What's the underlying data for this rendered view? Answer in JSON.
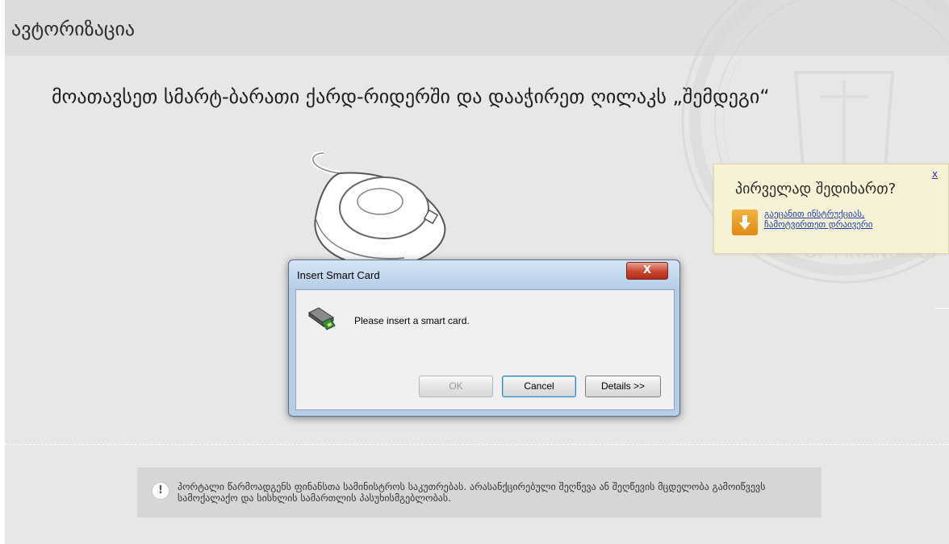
{
  "header": {
    "title": "ავტორიზაცია"
  },
  "main": {
    "instruction": "მოათავსეთ სმარტ-ბარათი ქარდ-რიდერში და დააჭირეთ ღილაკს „შემდეგი“"
  },
  "help_box": {
    "title": "პირველად შედიხართ?",
    "close_label": "x",
    "link_text": "გაეცანით ინსტრუქციას, ჩამოტვირთეთ დრაივერი",
    "icon": "download-icon"
  },
  "dialog": {
    "title": "Insert Smart Card",
    "close_label": "X",
    "message": "Please insert a smart card.",
    "icon": "smart-card-reader-icon",
    "buttons": {
      "ok": "OK",
      "cancel": "Cancel",
      "details": "Details >>"
    }
  },
  "notice": {
    "icon": "exclamation-icon",
    "icon_label": "!",
    "text": "პორტალი წარმოადგენს ფინანსთა სამინისტროს საკუთრებას. არასანქცირებული შეღწევა ან შეღწევის მცდელობა გამოიწვევს სამოქალაქო და სისხლის სამართლის პასუხისმგებლობას."
  },
  "colors": {
    "background": "#e7e7e7",
    "header": "#dcdcdc",
    "help_box": "#f7f1d5",
    "link": "#1a3fb0",
    "download_icon": "#e8951c",
    "dialog_frame": "#b6cde6",
    "close_button": "#c8442f"
  }
}
